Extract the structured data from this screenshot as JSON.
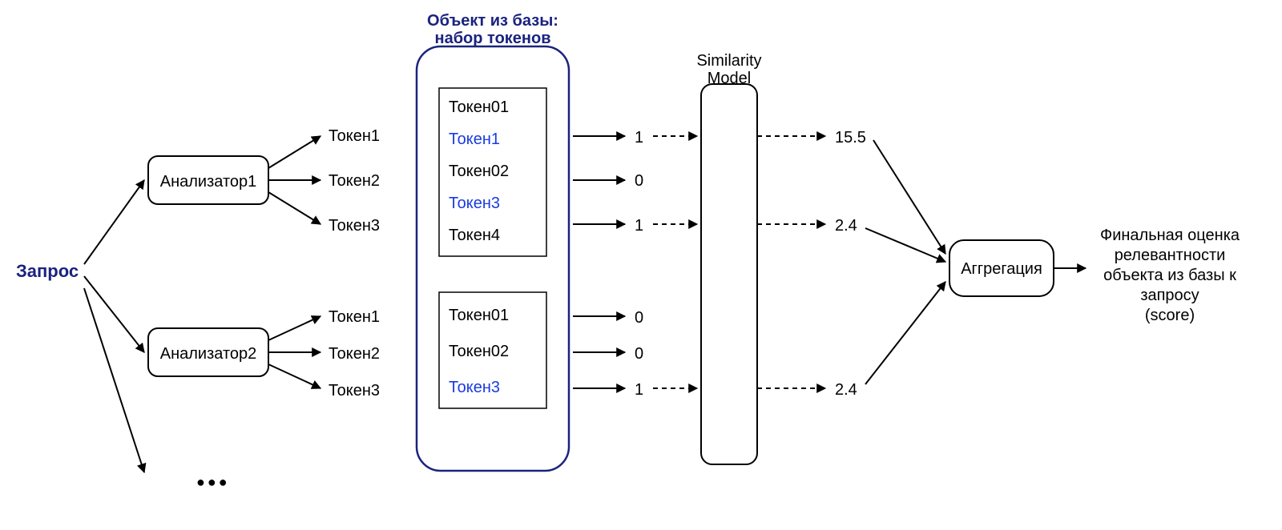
{
  "root": {
    "label": "Запрос"
  },
  "analyzers": [
    {
      "name": "Анализатор1",
      "tokens": [
        "Токен1",
        "Токен2",
        "Токен3"
      ]
    },
    {
      "name": "Анализатор2",
      "tokens": [
        "Токен1",
        "Токен2",
        "Токен3"
      ]
    }
  ],
  "ellipsis": "●●●",
  "tokenSetBox": {
    "title_line1": "Объект из базы:",
    "title_line2": "набор токенов",
    "groups": [
      {
        "tokens": [
          {
            "text": "Токен01",
            "matched": false
          },
          {
            "text": "Токен1",
            "matched": true
          },
          {
            "text": "Токен02",
            "matched": false
          },
          {
            "text": "Токен3",
            "matched": true
          },
          {
            "text": "Токен4",
            "matched": false
          }
        ]
      },
      {
        "tokens": [
          {
            "text": "Токен01",
            "matched": false
          },
          {
            "text": "Токен02",
            "matched": false
          },
          {
            "text": "Токен3",
            "matched": true
          }
        ]
      }
    ]
  },
  "matchFlags": {
    "group1": [
      "1",
      "0",
      "1"
    ],
    "group2": [
      "0",
      "0",
      "1"
    ]
  },
  "simModel": {
    "title_line1": "Similarity",
    "title_line2": "Model"
  },
  "simScores": [
    "15.5",
    "2.4",
    "2.4"
  ],
  "aggregation": {
    "label": "Аггрегация"
  },
  "finalText": {
    "l1": "Финальная оценка",
    "l2": "релевантности",
    "l3": "объекта из базы к",
    "l4": "запросу",
    "l5": "(score)"
  }
}
